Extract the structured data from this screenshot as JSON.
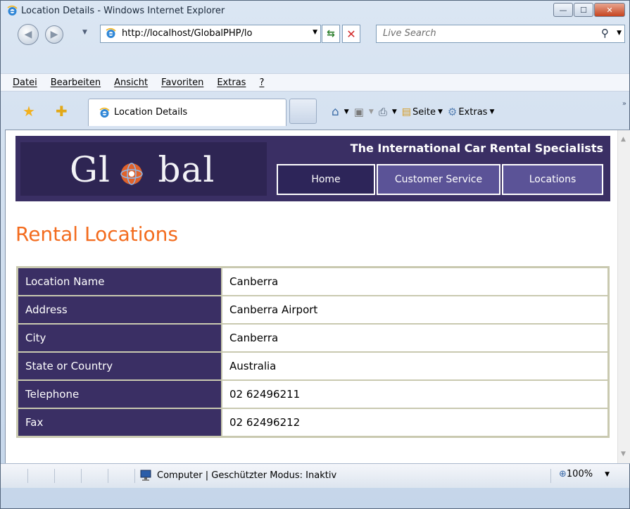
{
  "window": {
    "title": "Location Details - Windows Internet Explorer"
  },
  "navigation": {
    "address": "http://localhost/GlobalPHP/lo",
    "search_placeholder": "Live Search"
  },
  "menu": [
    "Datei",
    "Bearbeiten",
    "Ansicht",
    "Favoriten",
    "Extras",
    "?"
  ],
  "tab": {
    "label": "Location Details"
  },
  "toolbar": {
    "page_label": "Seite",
    "tools_label": "Extras"
  },
  "page": {
    "logo": "Global",
    "tagline": "The International Car Rental Specialists",
    "nav": [
      "Home",
      "Customer Service",
      "Locations"
    ],
    "title": "Rental Locations",
    "rows": [
      {
        "label": "Location Name",
        "value": "Canberra"
      },
      {
        "label": "Address",
        "value": "Canberra Airport"
      },
      {
        "label": "City",
        "value": "Canberra"
      },
      {
        "label": "State or Country",
        "value": "Australia"
      },
      {
        "label": "Telephone",
        "value": "02 62496211"
      },
      {
        "label": "Fax",
        "value": "02 62496212"
      }
    ]
  },
  "status": {
    "text": "Computer | Geschützter Modus: Inaktiv",
    "zoom": "100%"
  },
  "colors": {
    "header_bg": "#3a2f64",
    "title_orange": "#f36b1d",
    "nav_inactive": "#5b5397"
  }
}
